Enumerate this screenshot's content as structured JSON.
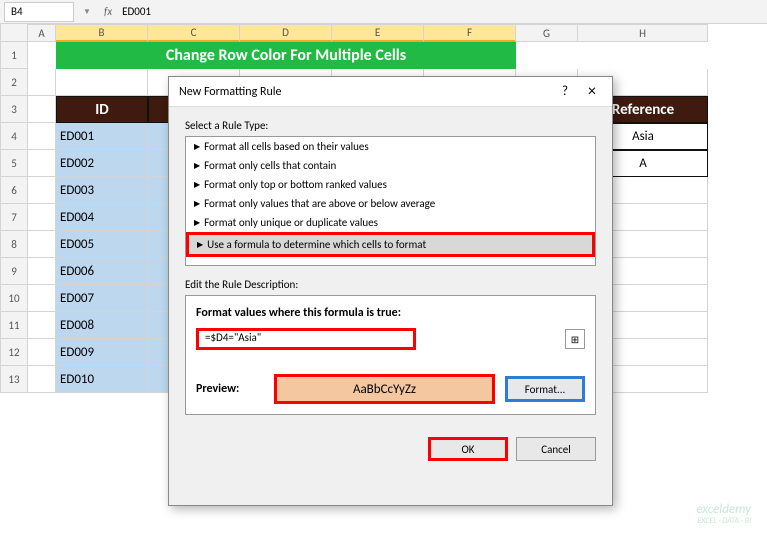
{
  "formula_bar": {
    "name": "B4",
    "fx": "fx",
    "value": "ED001"
  },
  "columns": [
    "A",
    "B",
    "C",
    "D",
    "E",
    "F",
    "G",
    "H"
  ],
  "row_nums": [
    "1",
    "2",
    "3",
    "4",
    "5",
    "6",
    "7",
    "8",
    "9",
    "10",
    "11",
    "12",
    "13"
  ],
  "title": "Change Row Color For Multiple Cells",
  "headers": {
    "id": "ID",
    "ref": "Reference"
  },
  "ids": [
    "ED001",
    "ED002",
    "ED003",
    "ED004",
    "ED005",
    "ED006",
    "ED007",
    "ED008",
    "ED009",
    "ED010"
  ],
  "refs": [
    "Asia",
    "A"
  ],
  "dialog": {
    "title": "New Formatting Rule",
    "select_label": "Select a Rule Type:",
    "rules": [
      "Format all cells based on their values",
      "Format only cells that contain",
      "Format only top or bottom ranked values",
      "Format only values that are above or below average",
      "Format only unique or duplicate values",
      "Use a formula to determine which cells to format"
    ],
    "edit_label": "Edit the Rule Description:",
    "formula_label": "Format values where this formula is true:",
    "formula": "=$D4=\"Asia\"",
    "preview_label": "Preview:",
    "preview_text": "AaBbCcYyZz",
    "format_btn": "Format...",
    "ok": "OK",
    "cancel": "Cancel"
  },
  "watermark": {
    "l1": "exceldemy",
    "l2": "EXCEL · DATA · BI"
  }
}
